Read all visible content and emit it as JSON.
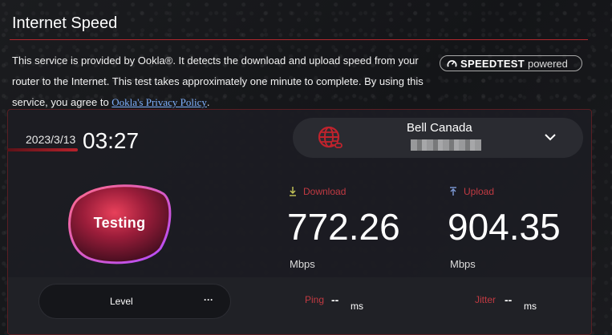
{
  "header": {
    "title": "Internet Speed",
    "desc_part1": "This service is provided by Ookla®. It detects the download and upload speed from your router to the Internet. This test takes approximately one minute to complete. By using this service, you agree to ",
    "privacy_link": "Ookla's Privacy Policy",
    "desc_part2": "."
  },
  "badge": {
    "brand": "SPEEDTEST",
    "suffix": "powered"
  },
  "test": {
    "date": "2023/3/13",
    "time": "03:27",
    "status": "Testing"
  },
  "isp": {
    "name": "Bell Canada"
  },
  "download": {
    "label": "Download",
    "value": "772.26",
    "unit": "Mbps"
  },
  "upload": {
    "label": "Upload",
    "value": "904.35",
    "unit": "Mbps"
  },
  "footer": {
    "level_label": "Level",
    "level_value": "···",
    "ping_label": "Ping",
    "ping_value": "--",
    "ping_unit": "ms",
    "jitter_label": "Jitter",
    "jitter_value": "--",
    "jitter_unit": "ms"
  },
  "colors": {
    "accent_red": "#b0282e",
    "link": "#7fb2ff",
    "label_red": "#c23a42"
  },
  "icons": [
    "speedtest-gauge-icon",
    "globe-link-icon",
    "chevron-down-icon",
    "download-arrow-icon",
    "upload-arrow-icon"
  ]
}
